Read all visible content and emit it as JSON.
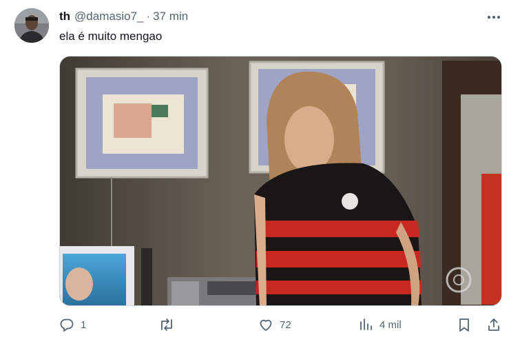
{
  "tweet": {
    "author_name": "th",
    "author_handle": "@damasio7_",
    "separator": "·",
    "timestamp": "37 min",
    "text": "ela é muito mengao"
  },
  "actions": {
    "reply_count": "1",
    "retweet_count": "",
    "like_count": "72",
    "view_count": "4 mil"
  },
  "icons": {
    "more": "more-horizontal-icon",
    "reply": "reply-icon",
    "retweet": "retweet-icon",
    "like": "heart-icon",
    "views": "views-icon",
    "bookmark": "bookmark-icon",
    "share": "share-icon"
  },
  "colors": {
    "text_primary": "#0f1419",
    "text_secondary": "#536471",
    "border": "#cfd9de",
    "shirt_red": "#c8281f",
    "shirt_black": "#1a1616"
  }
}
